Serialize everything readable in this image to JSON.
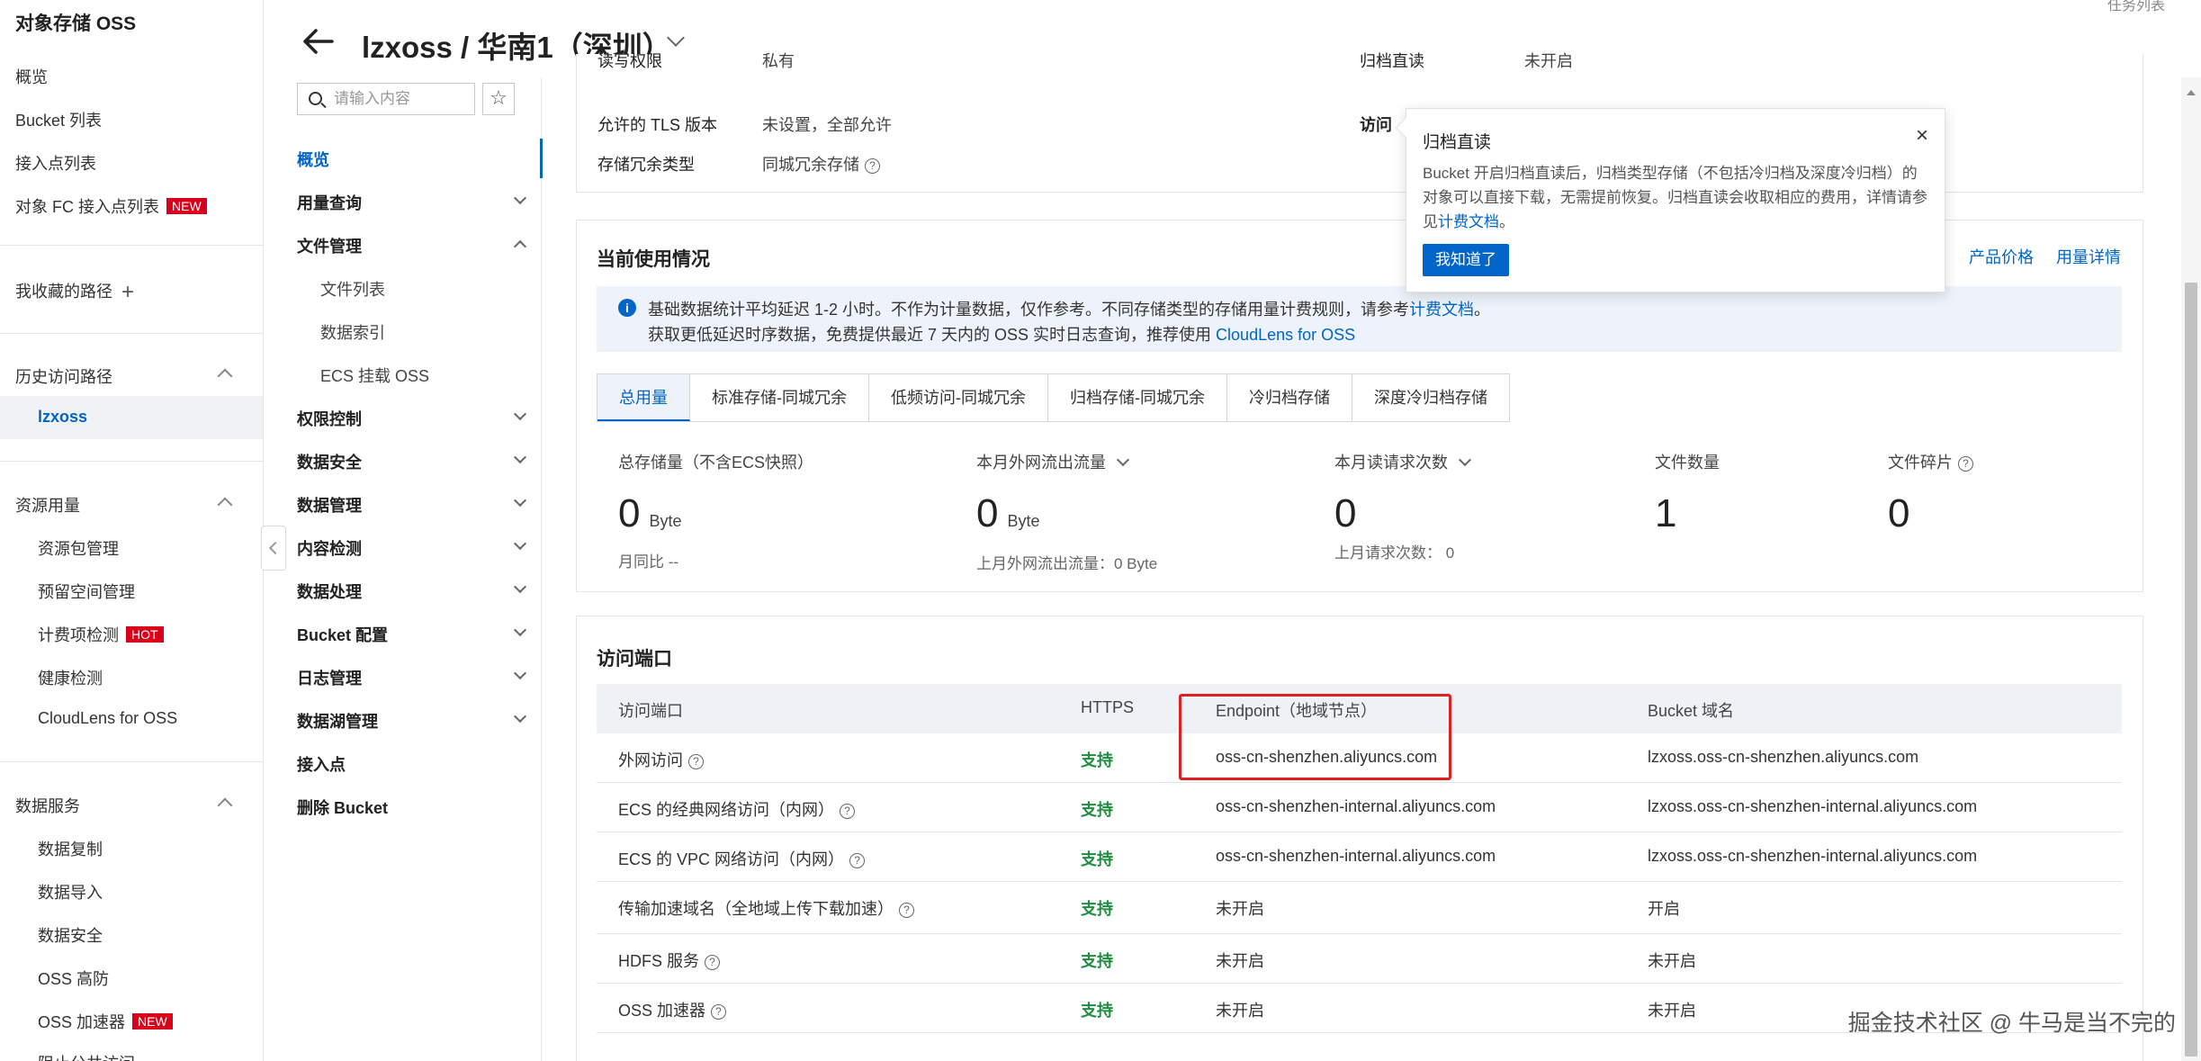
{
  "left_nav": {
    "title": "对象存储 OSS",
    "items": [
      "概览",
      "Bucket 列表",
      "接入点列表"
    ],
    "fc_item": {
      "label": "对象 FC 接入点列表",
      "badge": "NEW"
    },
    "favorites": "我收藏的路径",
    "history_header": "历史访问路径",
    "history_active": "lzxoss",
    "resource_header": "资源用量",
    "resource_items": [
      "资源包管理",
      "预留空间管理"
    ],
    "billing_item": {
      "label": "计费项检测",
      "badge": "HOT"
    },
    "resource_items2": [
      "健康检测",
      "CloudLens for OSS"
    ],
    "data_header": "数据服务",
    "data_items": [
      "数据复制",
      "数据导入",
      "数据安全",
      "OSS 高防"
    ],
    "accel_item": {
      "label": "OSS 加速器",
      "badge": "NEW"
    },
    "cut_item": "阻止公共访问"
  },
  "header": {
    "title": "lzxoss / 华南1（深圳）",
    "top_right": "任务列表"
  },
  "mid_nav": {
    "search_placeholder": "请输入内容",
    "items": [
      "概览",
      "用量查询",
      "文件管理",
      "文件列表",
      "数据索引",
      "ECS 挂载 OSS",
      "权限控制",
      "数据安全",
      "数据管理",
      "内容检测",
      "数据处理",
      "Bucket 配置",
      "日志管理",
      "数据湖管理",
      "接入点",
      "删除 Bucket"
    ]
  },
  "info": {
    "row0_label": "读写权限",
    "row0_value": "私有",
    "row0b_label": "归档直读",
    "row0b_value": "未开启",
    "tls_label": "允许的 TLS 版本",
    "tls_value": "未设置，全部允许",
    "access_label": "访问",
    "redundancy_label": "存储冗余类型",
    "redundancy_value": "同城冗余存储"
  },
  "usage": {
    "title": "当前使用情况",
    "links": [
      "产品价格",
      "用量详情"
    ],
    "notice_line1": "基础数据统计平均延迟 1-2 小时。不作为计量数据，仅作参考。不同存储类型的存储用量计费规则，请参考",
    "notice_link1": "计费文档",
    "notice_line1_end": "。",
    "notice_line2": "获取更低延迟时序数据，免费提供最近 7 天内的 OSS 实时日志查询，推荐使用",
    "notice_link2": "CloudLens for OSS",
    "tabs": [
      "总用量",
      "标准存储-同城冗余",
      "低频访问-同城冗余",
      "归档存储-同城冗余",
      "冷归档存储",
      "深度冷归档存储"
    ],
    "stats": [
      {
        "label": "总存储量（不含ECS快照）",
        "value": "0",
        "unit": "Byte",
        "sub": "月同比 --"
      },
      {
        "label": "本月外网流出流量",
        "value": "0",
        "unit": "Byte",
        "sub": "上月外网流出流量：0 Byte"
      },
      {
        "label": "本月读请求次数",
        "value": "0",
        "unit": "",
        "sub": "上月请求次数：  0"
      },
      {
        "label": "文件数量",
        "value": "1",
        "unit": "",
        "sub": ""
      },
      {
        "label": "文件碎片",
        "value": "0",
        "unit": "",
        "sub": ""
      }
    ]
  },
  "endpoints": {
    "title": "访问端口",
    "columns": [
      "访问端口",
      "HTTPS",
      "Endpoint（地域节点）",
      "Bucket 域名"
    ],
    "rows": [
      {
        "name": "外网访问",
        "https": "支持",
        "endpoint": "oss-cn-shenzhen.aliyuncs.com",
        "domain": "lzxoss.oss-cn-shenzhen.aliyuncs.com"
      },
      {
        "name": "ECS 的经典网络访问（内网）",
        "https": "支持",
        "endpoint": "oss-cn-shenzhen-internal.aliyuncs.com",
        "domain": "lzxoss.oss-cn-shenzhen-internal.aliyuncs.com"
      },
      {
        "name": "ECS 的 VPC 网络访问（内网）",
        "https": "支持",
        "endpoint": "oss-cn-shenzhen-internal.aliyuncs.com",
        "domain": "lzxoss.oss-cn-shenzhen-internal.aliyuncs.com"
      },
      {
        "name": "传输加速域名（全地域上传下载加速）",
        "https": "支持",
        "endpoint": "未开启",
        "domain": "开启"
      },
      {
        "name": "HDFS 服务",
        "https": "支持",
        "endpoint": "未开启",
        "domain": "未开启"
      },
      {
        "name": "OSS 加速器",
        "https": "支持",
        "endpoint": "未开启",
        "domain": "未开启"
      }
    ]
  },
  "popover": {
    "title": "归档直读",
    "body": "Bucket 开启归档直读后，归档类型存储（不包括冷归档及深度冷归档）的对象可以直接下载，无需提前恢复。归档直读会收取相应的费用，详情请参见",
    "body_link": "计费文档",
    "body_end": "。",
    "button": "我知道了"
  },
  "watermark": "掘金技术社区 @ 牛马是当不完的",
  "colors": {
    "accent": "#0064c8",
    "success": "#1e8e3e",
    "badge": "#d9001b",
    "highlight": "#e02020"
  }
}
